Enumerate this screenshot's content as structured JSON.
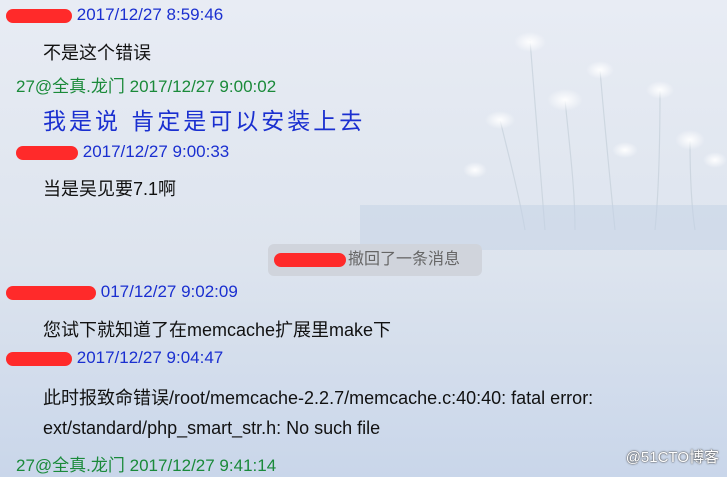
{
  "messages": [
    {
      "time": "2017/12/27 8:59:46",
      "text": "不是这个错误"
    },
    {
      "sender": "27@全真.龙门",
      "time": "2017/12/27 9:00:02",
      "text": "我是说 肯定是可以安装上去"
    },
    {
      "time": "2017/12/27 9:00:33",
      "text": "当是吴见要7.1啊"
    },
    {
      "time_partial": "017/12/27 9:02:09",
      "text": "您试下就知道了在memcache扩展里make下"
    },
    {
      "time": "2017/12/27 9:04:47",
      "text_line1": "此时报致命错误/root/memcache-2.2.7/memcache.c:40:40: fatal error:",
      "text_line2": "ext/standard/php_smart_str.h: No such file"
    },
    {
      "sender": "27@全真.龙门",
      "time": "2017/12/27 9:41:14"
    }
  ],
  "recall_notice": "撤回了一条消息",
  "watermark": "@51CTO博客",
  "colors": {
    "self_header": "#1a2fd0",
    "other_header": "#1a8a3a",
    "redaction": "#ff2a2a"
  }
}
